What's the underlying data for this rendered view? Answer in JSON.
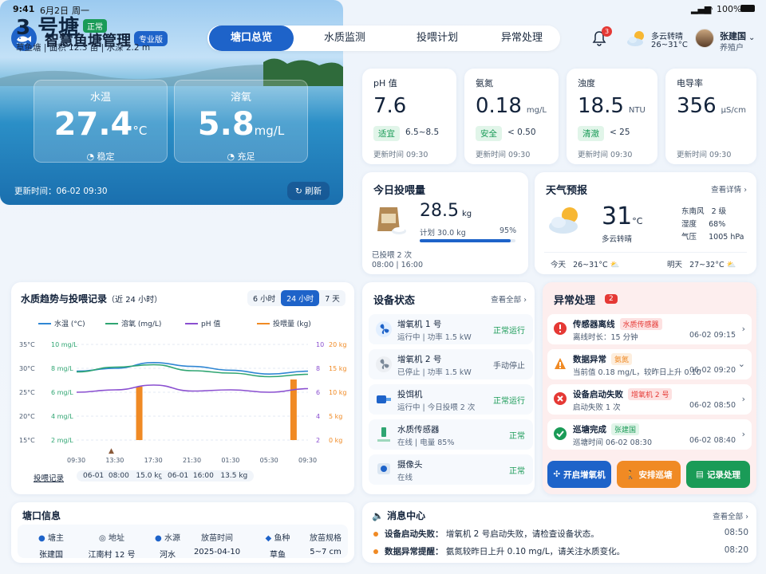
{
  "status_bar": {
    "time": "9:41",
    "date": "6月2日",
    "weekday": "周一",
    "battery": "100%"
  },
  "header": {
    "title": "智慧鱼塘管理",
    "badge": "专业版",
    "nav": [
      "塘口总览",
      "水质监测",
      "投喂计划",
      "异常处理"
    ],
    "active_nav": 0,
    "notif_count": "3",
    "weather_desc": "多云转晴",
    "weather_temp": "26~31°C",
    "user_name": "张建国",
    "user_role": "养殖户"
  },
  "pond": {
    "name": "3 号塘",
    "status": "正常",
    "fish": "草鱼塘",
    "area": "面积 12.3 亩",
    "depth": "水深 2.2 m",
    "temp_label": "水温",
    "temp_value": "27.4",
    "temp_unit": "°C",
    "temp_state": "稳定",
    "do_label": "溶氧",
    "do_value": "5.8",
    "do_unit": "mg/L",
    "do_state": "充足",
    "updated": "更新时间：06-02 09:30",
    "refresh": "刷新"
  },
  "metrics": [
    {
      "label": "pH 值",
      "value": "7.6",
      "unit": "",
      "tag": "适宜",
      "range": "6.5~8.5",
      "updated": "更新时间 09:30"
    },
    {
      "label": "氨氮",
      "value": "0.18",
      "unit": "mg/L",
      "tag": "安全",
      "range": "< 0.50",
      "updated": "更新时间 09:30"
    },
    {
      "label": "浊度",
      "value": "18.5",
      "unit": "NTU",
      "tag": "清澈",
      "range": "< 25",
      "updated": "更新时间 09:30"
    },
    {
      "label": "电导率",
      "value": "356",
      "unit": "μS/cm",
      "tag": "",
      "range": "",
      "updated": "更新时间 09:30"
    }
  ],
  "feed": {
    "title": "今日投喂量",
    "value": "28.5",
    "unit": "kg",
    "plan": "计划 30.0 kg",
    "percent": "95%",
    "progress": 0.95,
    "fed_count": "已投喂 2 次",
    "times": "08:00 | 16:00"
  },
  "weather": {
    "title": "天气预报",
    "more": "查看详情",
    "temp": "31",
    "unit": "°C",
    "desc": "多云转晴",
    "wind_label": "东南风",
    "wind": "2 级",
    "humidity_label": "湿度",
    "humidity": "68%",
    "pressure_label": "气压",
    "pressure": "1005 hPa",
    "today_label": "今天",
    "today": "26~31°C",
    "tomorrow_label": "明天",
    "tomorrow": "27~32°C"
  },
  "trend": {
    "title": "水质趋势与投喂记录",
    "subtitle": "（近 24 小时）",
    "ranges": [
      "6 小时",
      "24 小时",
      "7 天"
    ],
    "active_range": 1,
    "feed_label": "投喂记录",
    "feed_records": [
      {
        "date": "06-01",
        "time": "08:00",
        "amount": "15.0 kg"
      },
      {
        "date": "06-01",
        "time": "16:00",
        "amount": "13.5 kg"
      }
    ]
  },
  "chart_data": {
    "type": "line",
    "x": [
      "09:30",
      "13:30",
      "17:30",
      "21:30",
      "01:30",
      "05:30",
      "09:30"
    ],
    "series": [
      {
        "name": "水温 (°C)",
        "color": "#2f86d3",
        "axis": "left_temp",
        "values": [
          29.4,
          30.0,
          31.2,
          30.4,
          29.6,
          28.8,
          29.4
        ]
      },
      {
        "name": "溶氧 (mg/L)",
        "color": "#2fa572",
        "axis": "left_do",
        "values": [
          7.7,
          8.1,
          8.3,
          7.8,
          7.6,
          7.3,
          7.5
        ]
      },
      {
        "name": "pH 值",
        "color": "#8a4fd0",
        "axis": "right_ph",
        "values": [
          6.0,
          6.2,
          6.6,
          6.1,
          6.2,
          6.0,
          6.3
        ]
      },
      {
        "name": "投喂量 (kg)",
        "color": "#f08a24",
        "axis": "right_feed",
        "type": "bar",
        "bars": [
          {
            "x": "08:00",
            "value": 15.0
          },
          {
            "x": "16:00",
            "value": 13.5
          }
        ]
      }
    ],
    "axes": {
      "left_temp": {
        "ticks": [
          "35°C",
          "30°C",
          "25°C",
          "20°C",
          "15°C"
        ],
        "range": [
          15,
          35
        ]
      },
      "left_do": {
        "ticks": [
          "10 mg/L",
          "8 mg/L",
          "6 mg/L",
          "4 mg/L",
          "2 mg/L"
        ],
        "range": [
          2,
          10
        ]
      },
      "right_ph": {
        "ticks": [
          "10",
          "8",
          "6",
          "4",
          "2"
        ],
        "range": [
          2,
          10
        ]
      },
      "right_feed": {
        "ticks": [
          "20 kg",
          "15 kg",
          "10 kg",
          "5 kg",
          "0 kg"
        ],
        "range": [
          0,
          20
        ]
      }
    },
    "grid": true,
    "legend": "top"
  },
  "devices": {
    "title": "设备状态",
    "more": "查看全部",
    "items": [
      {
        "name": "增氧机 1 号",
        "detail": "运行中 | 功率 1.5 kW",
        "status": "正常运行",
        "icon": "fan-icon"
      },
      {
        "name": "增氧机 2 号",
        "detail": "已停止 | 功率 1.5 kW",
        "status": "手动停止",
        "icon": "fan-icon"
      },
      {
        "name": "投饵机",
        "detail": "运行中 | 今日投喂 2 次",
        "status": "正常运行",
        "icon": "feeder-icon"
      },
      {
        "name": "水质传感器",
        "detail": "在线 | 电量 85%",
        "status": "正常",
        "icon": "sensor-icon"
      },
      {
        "name": "摄像头",
        "detail": "在线",
        "status": "正常",
        "icon": "camera-icon"
      }
    ]
  },
  "alerts": {
    "title": "异常处理",
    "count": "2",
    "items": [
      {
        "name": "传感器离线",
        "tag": "水质传感器",
        "detail": "离线时长：15 分钟",
        "time": "06-02 09:15",
        "color": "#e53935"
      },
      {
        "name": "数据异常",
        "tag": "氨氮",
        "detail": "当前值 0.18 mg/L，较昨日上升 0.10",
        "time": "06-02 09:20",
        "color": "#f08a24"
      },
      {
        "name": "设备启动失败",
        "tag": "增氧机 2 号",
        "detail": "启动失败 1 次",
        "time": "06-02 08:50",
        "color": "#e53935"
      },
      {
        "name": "巡塘完成",
        "tag": "张建国",
        "detail": "巡塘时间 06-02 08:30",
        "time": "06-02 08:40",
        "color": "#1a9b57"
      }
    ],
    "actions": [
      "开启增氧机",
      "安排巡塘",
      "记录处理"
    ]
  },
  "pond_info": {
    "title": "塘口信息",
    "cols": [
      {
        "h": "塘主",
        "v": "张建国"
      },
      {
        "h": "地址",
        "v": "江南村 12 号"
      },
      {
        "h": "水源",
        "v": "河水"
      },
      {
        "h": "放苗时间",
        "v": "2025-04-10"
      },
      {
        "h": "鱼种",
        "v": "草鱼"
      },
      {
        "h": "放苗规格",
        "v": "5~7 cm"
      }
    ]
  },
  "messages": {
    "title": "消息中心",
    "more": "查看全部",
    "items": [
      {
        "label": "设备启动失败：",
        "text": "增氧机 2 号启动失败，请检查设备状态。",
        "time": "08:50"
      },
      {
        "label": "数据异常提醒：",
        "text": "氨氮较昨日上升 0.10 mg/L，请关注水质变化。",
        "time": "08:20"
      }
    ]
  }
}
